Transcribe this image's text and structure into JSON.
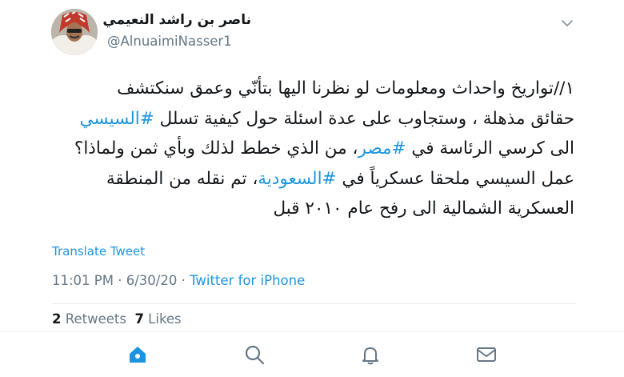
{
  "author": {
    "name": "ناصر بن راشد النعيمي",
    "handle": "@AlnuaimiNasser1"
  },
  "tweet": {
    "lines": [
      [
        {
          "text": "١//تواريخ  واحداث ومعلومات لو نظرنا اليها بتأنّي وعمق سنكتشف",
          "tag": false
        }
      ],
      [
        {
          "text": "حقائق مذهلة ، وستجاوب على عدة اسئلة حول كيفية تسلل ",
          "tag": false
        },
        {
          "text": "#السيسي",
          "tag": true
        }
      ],
      [
        {
          "text": "الى كرسي الرئاسة في ",
          "tag": false
        },
        {
          "text": "#مصر",
          "tag": true
        },
        {
          "text": "، من الذي خطط لذلك وبأي ثمن ولماذا؟",
          "tag": false
        }
      ],
      [
        {
          "text": "عمل السيسي ملحقا عسكرياً في ",
          "tag": false
        },
        {
          "text": "#السعودية",
          "tag": true
        },
        {
          "text": "، تم نقله من المنطقة",
          "tag": false
        }
      ],
      [
        {
          "text": "العسكرية الشمالية الى رفح عام ٢٠١٠ قبل",
          "tag": false
        }
      ]
    ],
    "translate_label": "Translate Tweet",
    "timestamp": "11:01 PM · 6/30/20 · ",
    "source": "Twitter for iPhone"
  },
  "stats": {
    "retweets_count": "2",
    "retweets_label": " Retweets",
    "likes_count": "7",
    "likes_label": " Likes"
  },
  "tabbar": {
    "items": [
      {
        "icon": "home-icon",
        "active": true
      },
      {
        "icon": "search-icon",
        "active": false
      },
      {
        "icon": "bell-icon",
        "active": false
      },
      {
        "icon": "mail-icon",
        "active": false
      }
    ]
  },
  "colors": {
    "accent": "#1b95e0",
    "secondary_text": "#657786",
    "divider": "#e6ecf0"
  }
}
